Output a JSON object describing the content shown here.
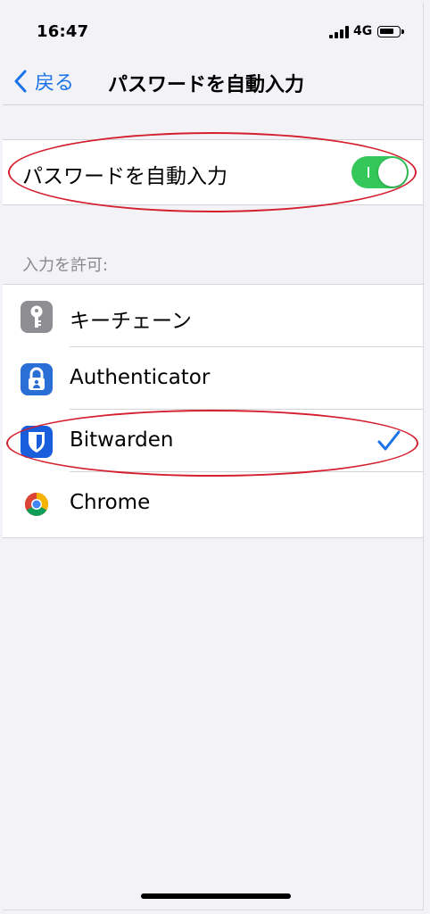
{
  "status_bar": {
    "time": "16:47",
    "network": "4G",
    "icons": [
      "signal-bars-icon",
      "battery-icon"
    ]
  },
  "nav": {
    "back_label": "戻る",
    "title": "パスワードを自動入力"
  },
  "autofill": {
    "label": "パスワードを自動入力",
    "toggle_on": true,
    "toggle_color": "#34c759"
  },
  "section": {
    "header": "入力を許可:"
  },
  "providers": [
    {
      "label": "キーチェーン",
      "icon": "keychain-icon",
      "selected": false
    },
    {
      "label": "Authenticator",
      "icon": "authenticator-icon",
      "selected": false
    },
    {
      "label": "Bitwarden",
      "icon": "bitwarden-icon",
      "selected": true
    },
    {
      "label": "Chrome",
      "icon": "chrome-icon",
      "selected": false
    }
  ],
  "colors": {
    "accent": "#1a73e8",
    "annotation": "#d4202f",
    "background": "#f2f2f7"
  }
}
